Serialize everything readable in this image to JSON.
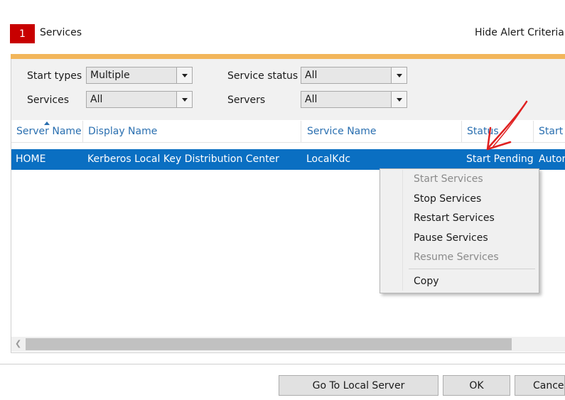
{
  "header": {
    "badge": "1",
    "title": "Services",
    "hide_link": "Hide Alert Criteria"
  },
  "filters": {
    "start_types_label": "Start types",
    "start_types_value": "Multiple",
    "service_status_label": "Service status",
    "service_status_value": "All",
    "services_label": "Services",
    "services_value": "All",
    "servers_label": "Servers",
    "servers_value": "All"
  },
  "table": {
    "columns": [
      "Server Name",
      "Display Name",
      "Service Name",
      "Status",
      "Start T"
    ],
    "rows": [
      [
        "HOME",
        "Kerberos Local Key Distribution Center",
        "LocalKdc",
        "Start Pending",
        "Autor"
      ]
    ]
  },
  "context_menu": {
    "items": [
      {
        "label": "Start Services",
        "enabled": false
      },
      {
        "label": "Stop Services",
        "enabled": true
      },
      {
        "label": "Restart Services",
        "enabled": true
      },
      {
        "label": "Pause Services",
        "enabled": true
      },
      {
        "label": "Resume Services",
        "enabled": false
      },
      {
        "label": "Copy",
        "enabled": true
      }
    ]
  },
  "footer": {
    "local_server_button": "Go To Local Server",
    "ok_button": "OK",
    "cancel_button": "Cancel"
  },
  "colors": {
    "accent_bar": "#f2b65b",
    "selection": "#0a6fc2",
    "badge": "#c80000",
    "annotation_arrow": "#e02020"
  }
}
